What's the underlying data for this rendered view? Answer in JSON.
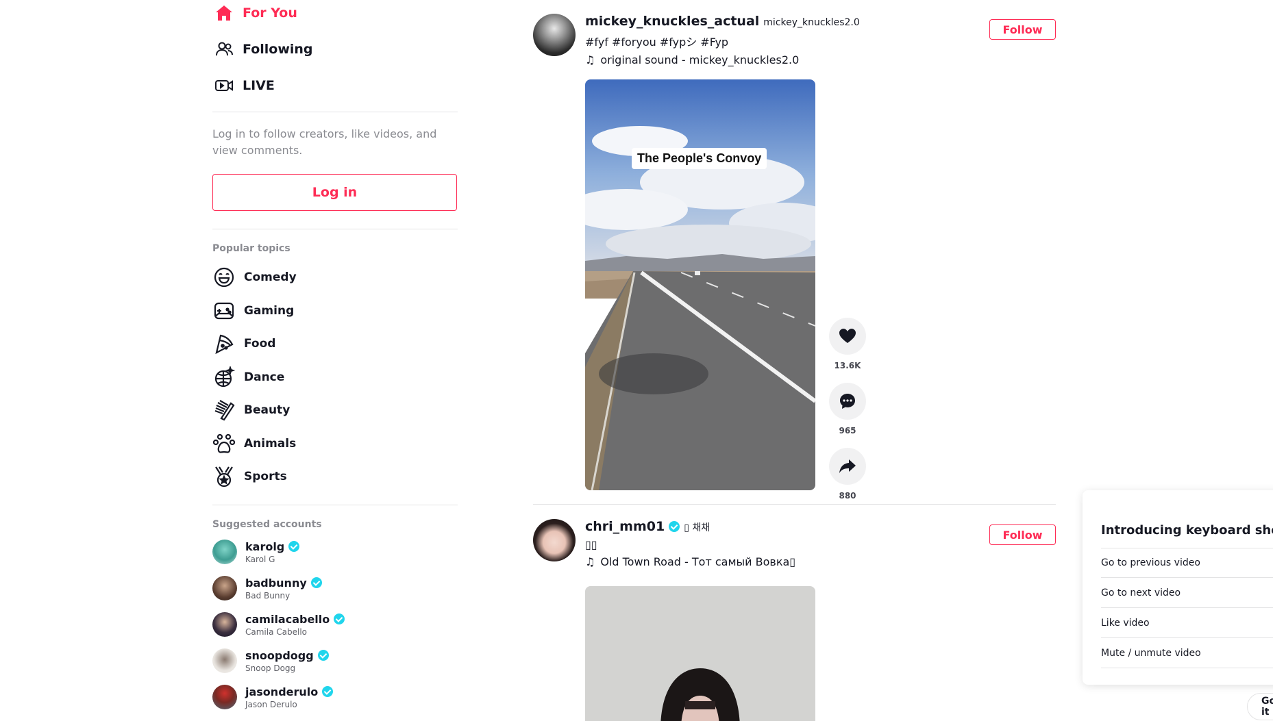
{
  "nav": {
    "items": [
      {
        "label": "For You",
        "icon": "home-icon",
        "active": true
      },
      {
        "label": "Following",
        "icon": "people-icon",
        "active": false
      },
      {
        "label": "LIVE",
        "icon": "live-video-icon",
        "active": false
      }
    ]
  },
  "login": {
    "hint": "Log in to follow creators, like videos, and view comments.",
    "button_label": "Log in"
  },
  "topics": {
    "title": "Popular topics",
    "items": [
      {
        "label": "Comedy",
        "icon": "smile-icon"
      },
      {
        "label": "Gaming",
        "icon": "gamepad-icon"
      },
      {
        "label": "Food",
        "icon": "pizza-icon"
      },
      {
        "label": "Dance",
        "icon": "disco-ball-icon"
      },
      {
        "label": "Beauty",
        "icon": "comb-icon"
      },
      {
        "label": "Animals",
        "icon": "paw-icon"
      },
      {
        "label": "Sports",
        "icon": "medal-icon"
      }
    ]
  },
  "suggested": {
    "title": "Suggested accounts",
    "accounts": [
      {
        "username": "karolg",
        "name": "Karol G"
      },
      {
        "username": "badbunny",
        "name": "Bad Bunny"
      },
      {
        "username": "camilacabello",
        "name": "Camila Cabello"
      },
      {
        "username": "snoopdogg",
        "name": "Snoop Dogg"
      },
      {
        "username": "jasonderulo",
        "name": "Jason Derulo"
      }
    ]
  },
  "posts": [
    {
      "author": "mickey_knuckles_actual",
      "handle": "mickey_knuckles2.0",
      "caption": "#fyf #foryou #fypシ #Fyp",
      "music": "original sound - mickey_knuckles2.0",
      "follow_label": "Follow",
      "video_overlay": "The People's Convoy",
      "likes": "13.6K",
      "comments": "965",
      "shares": "880"
    },
    {
      "author": "chri_mm01",
      "handle": "▯ 채채",
      "caption": "▯▯",
      "music": "Old Town Road - Тот самый Вовка▯",
      "follow_label": "Follow"
    }
  ],
  "keyboard": {
    "title": "Introducing keyboard shortcuts!",
    "rows": [
      "Go to previous video",
      "Go to next video",
      "Like video",
      "Mute / unmute video"
    ],
    "get_button": "Got it"
  },
  "colors": {
    "accent": "#fe2c55",
    "verified": "#20d5ec",
    "text": "#161823"
  }
}
